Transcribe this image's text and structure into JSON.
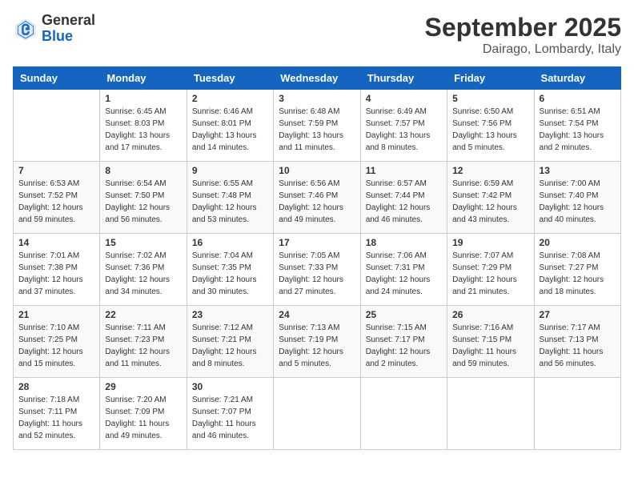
{
  "header": {
    "logo_line1": "General",
    "logo_line2": "Blue",
    "month": "September 2025",
    "location": "Dairago, Lombardy, Italy"
  },
  "weekdays": [
    "Sunday",
    "Monday",
    "Tuesday",
    "Wednesday",
    "Thursday",
    "Friday",
    "Saturday"
  ],
  "weeks": [
    [
      {
        "day": "",
        "sunrise": "",
        "sunset": "",
        "daylight": ""
      },
      {
        "day": "1",
        "sunrise": "Sunrise: 6:45 AM",
        "sunset": "Sunset: 8:03 PM",
        "daylight": "Daylight: 13 hours and 17 minutes."
      },
      {
        "day": "2",
        "sunrise": "Sunrise: 6:46 AM",
        "sunset": "Sunset: 8:01 PM",
        "daylight": "Daylight: 13 hours and 14 minutes."
      },
      {
        "day": "3",
        "sunrise": "Sunrise: 6:48 AM",
        "sunset": "Sunset: 7:59 PM",
        "daylight": "Daylight: 13 hours and 11 minutes."
      },
      {
        "day": "4",
        "sunrise": "Sunrise: 6:49 AM",
        "sunset": "Sunset: 7:57 PM",
        "daylight": "Daylight: 13 hours and 8 minutes."
      },
      {
        "day": "5",
        "sunrise": "Sunrise: 6:50 AM",
        "sunset": "Sunset: 7:56 PM",
        "daylight": "Daylight: 13 hours and 5 minutes."
      },
      {
        "day": "6",
        "sunrise": "Sunrise: 6:51 AM",
        "sunset": "Sunset: 7:54 PM",
        "daylight": "Daylight: 13 hours and 2 minutes."
      }
    ],
    [
      {
        "day": "7",
        "sunrise": "Sunrise: 6:53 AM",
        "sunset": "Sunset: 7:52 PM",
        "daylight": "Daylight: 12 hours and 59 minutes."
      },
      {
        "day": "8",
        "sunrise": "Sunrise: 6:54 AM",
        "sunset": "Sunset: 7:50 PM",
        "daylight": "Daylight: 12 hours and 56 minutes."
      },
      {
        "day": "9",
        "sunrise": "Sunrise: 6:55 AM",
        "sunset": "Sunset: 7:48 PM",
        "daylight": "Daylight: 12 hours and 53 minutes."
      },
      {
        "day": "10",
        "sunrise": "Sunrise: 6:56 AM",
        "sunset": "Sunset: 7:46 PM",
        "daylight": "Daylight: 12 hours and 49 minutes."
      },
      {
        "day": "11",
        "sunrise": "Sunrise: 6:57 AM",
        "sunset": "Sunset: 7:44 PM",
        "daylight": "Daylight: 12 hours and 46 minutes."
      },
      {
        "day": "12",
        "sunrise": "Sunrise: 6:59 AM",
        "sunset": "Sunset: 7:42 PM",
        "daylight": "Daylight: 12 hours and 43 minutes."
      },
      {
        "day": "13",
        "sunrise": "Sunrise: 7:00 AM",
        "sunset": "Sunset: 7:40 PM",
        "daylight": "Daylight: 12 hours and 40 minutes."
      }
    ],
    [
      {
        "day": "14",
        "sunrise": "Sunrise: 7:01 AM",
        "sunset": "Sunset: 7:38 PM",
        "daylight": "Daylight: 12 hours and 37 minutes."
      },
      {
        "day": "15",
        "sunrise": "Sunrise: 7:02 AM",
        "sunset": "Sunset: 7:36 PM",
        "daylight": "Daylight: 12 hours and 34 minutes."
      },
      {
        "day": "16",
        "sunrise": "Sunrise: 7:04 AM",
        "sunset": "Sunset: 7:35 PM",
        "daylight": "Daylight: 12 hours and 30 minutes."
      },
      {
        "day": "17",
        "sunrise": "Sunrise: 7:05 AM",
        "sunset": "Sunset: 7:33 PM",
        "daylight": "Daylight: 12 hours and 27 minutes."
      },
      {
        "day": "18",
        "sunrise": "Sunrise: 7:06 AM",
        "sunset": "Sunset: 7:31 PM",
        "daylight": "Daylight: 12 hours and 24 minutes."
      },
      {
        "day": "19",
        "sunrise": "Sunrise: 7:07 AM",
        "sunset": "Sunset: 7:29 PM",
        "daylight": "Daylight: 12 hours and 21 minutes."
      },
      {
        "day": "20",
        "sunrise": "Sunrise: 7:08 AM",
        "sunset": "Sunset: 7:27 PM",
        "daylight": "Daylight: 12 hours and 18 minutes."
      }
    ],
    [
      {
        "day": "21",
        "sunrise": "Sunrise: 7:10 AM",
        "sunset": "Sunset: 7:25 PM",
        "daylight": "Daylight: 12 hours and 15 minutes."
      },
      {
        "day": "22",
        "sunrise": "Sunrise: 7:11 AM",
        "sunset": "Sunset: 7:23 PM",
        "daylight": "Daylight: 12 hours and 11 minutes."
      },
      {
        "day": "23",
        "sunrise": "Sunrise: 7:12 AM",
        "sunset": "Sunset: 7:21 PM",
        "daylight": "Daylight: 12 hours and 8 minutes."
      },
      {
        "day": "24",
        "sunrise": "Sunrise: 7:13 AM",
        "sunset": "Sunset: 7:19 PM",
        "daylight": "Daylight: 12 hours and 5 minutes."
      },
      {
        "day": "25",
        "sunrise": "Sunrise: 7:15 AM",
        "sunset": "Sunset: 7:17 PM",
        "daylight": "Daylight: 12 hours and 2 minutes."
      },
      {
        "day": "26",
        "sunrise": "Sunrise: 7:16 AM",
        "sunset": "Sunset: 7:15 PM",
        "daylight": "Daylight: 11 hours and 59 minutes."
      },
      {
        "day": "27",
        "sunrise": "Sunrise: 7:17 AM",
        "sunset": "Sunset: 7:13 PM",
        "daylight": "Daylight: 11 hours and 56 minutes."
      }
    ],
    [
      {
        "day": "28",
        "sunrise": "Sunrise: 7:18 AM",
        "sunset": "Sunset: 7:11 PM",
        "daylight": "Daylight: 11 hours and 52 minutes."
      },
      {
        "day": "29",
        "sunrise": "Sunrise: 7:20 AM",
        "sunset": "Sunset: 7:09 PM",
        "daylight": "Daylight: 11 hours and 49 minutes."
      },
      {
        "day": "30",
        "sunrise": "Sunrise: 7:21 AM",
        "sunset": "Sunset: 7:07 PM",
        "daylight": "Daylight: 11 hours and 46 minutes."
      },
      {
        "day": "",
        "sunrise": "",
        "sunset": "",
        "daylight": ""
      },
      {
        "day": "",
        "sunrise": "",
        "sunset": "",
        "daylight": ""
      },
      {
        "day": "",
        "sunrise": "",
        "sunset": "",
        "daylight": ""
      },
      {
        "day": "",
        "sunrise": "",
        "sunset": "",
        "daylight": ""
      }
    ]
  ]
}
